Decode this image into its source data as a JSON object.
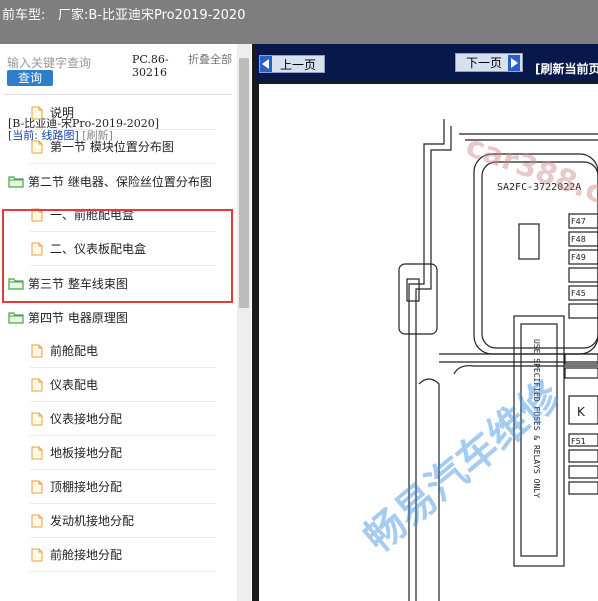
{
  "header": {
    "label": "前车型:",
    "maker": "厂家:B-比亚迪宋Pro2019-2020"
  },
  "search": {
    "placeholder": "输入关键字查询",
    "button": "查询",
    "code": "PC.86-30216",
    "collapse": "折叠全部"
  },
  "info": {
    "model": "[B-比亚迪-宋Pro-2019-2020]",
    "current": "[当前: 线路图]",
    "refresh": "[刷新]"
  },
  "tree": [
    {
      "label": "说明",
      "level": "child",
      "type": "file"
    },
    {
      "label": "第一节 模块位置分布图",
      "level": "child",
      "type": "file"
    },
    {
      "label": "第二节 继电器、保险丝位置分布图",
      "level": "parent",
      "type": "folder"
    },
    {
      "label": "一、前舱配电盒",
      "level": "child",
      "type": "file"
    },
    {
      "label": "二、仪表板配电盒",
      "level": "child",
      "type": "file"
    },
    {
      "label": "第三节 整车线束图",
      "level": "parent",
      "type": "folder"
    },
    {
      "label": "第四节 电器原理图",
      "level": "parent",
      "type": "folder"
    },
    {
      "label": "前舱配电",
      "level": "child",
      "type": "file"
    },
    {
      "label": "仪表配电",
      "level": "child",
      "type": "file"
    },
    {
      "label": "仪表接地分配",
      "level": "child",
      "type": "file"
    },
    {
      "label": "地板接地分配",
      "level": "child",
      "type": "file"
    },
    {
      "label": "顶棚接地分配",
      "level": "child",
      "type": "file"
    },
    {
      "label": "发动机接地分配",
      "level": "child",
      "type": "file"
    },
    {
      "label": "前舱接地分配",
      "level": "child",
      "type": "file"
    }
  ],
  "viewer": {
    "prev": "上一页",
    "next": "下一页",
    "refresh": "[刷新当前页]"
  },
  "diagram": {
    "part_no": "SA2FC-3722022A",
    "side_text": "USE SPECIFIED FUSES & RELAYS ONLY",
    "fuses": [
      "F47",
      "F48",
      "F49",
      "F45",
      "F51"
    ],
    "box_k": "K",
    "watermark_site": "car388.com",
    "watermark_brand": "畅易汽车维修"
  },
  "colors": {
    "topbar": "#7e7e7e",
    "toolbar": "#09184a",
    "accent": "#2f7fc8",
    "highlight": "#e23b3b",
    "folder": "#4aa34a",
    "file": "#e8a33a"
  }
}
